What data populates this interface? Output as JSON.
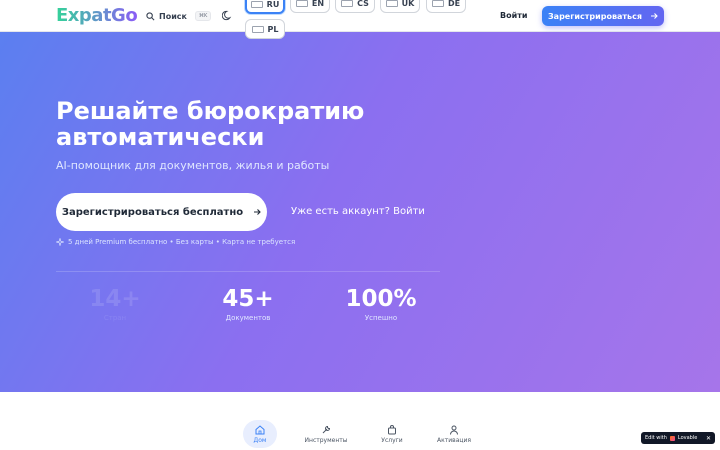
{
  "header": {
    "logo": "ExpatGo",
    "search_label": "Поиск",
    "search_shortcut": "⌘K",
    "login_label": "Войти",
    "register_label": "Зарегистрироваться"
  },
  "languages": [
    {
      "code": "RU",
      "active": true
    },
    {
      "code": "EN",
      "active": false
    },
    {
      "code": "CS",
      "active": false
    },
    {
      "code": "UK",
      "active": false
    },
    {
      "code": "DE",
      "active": false
    },
    {
      "code": "PL",
      "active": false
    }
  ],
  "hero": {
    "title": "Решайте бюрократию автоматически",
    "subtitle": "AI-помощник для документов, жилья и работы",
    "cta_label": "Зарегистрироваться бесплатно",
    "login_link": "Уже есть аккаунт? Войти",
    "perks": "5 дней Premium бесплатно • Без карты • Карта не требуется"
  },
  "stats": [
    {
      "value": "14+",
      "label": "Стран"
    },
    {
      "value": "45+",
      "label": "Документов"
    },
    {
      "value": "100%",
      "label": "Успешно"
    }
  ],
  "bottom_nav": [
    {
      "label": "Дом",
      "icon": "home-icon",
      "active": true
    },
    {
      "label": "Инструменты",
      "icon": "wrench-icon",
      "active": false
    },
    {
      "label": "Услуги",
      "icon": "bag-icon",
      "active": false
    },
    {
      "label": "Активация",
      "icon": "user-icon",
      "active": false
    }
  ],
  "badge": {
    "text": "Edit with",
    "brand": "Lovable"
  },
  "colors": {
    "accent": "#3b82f6",
    "hero_start": "#5b7ff0",
    "hero_end": "#a675ea"
  }
}
